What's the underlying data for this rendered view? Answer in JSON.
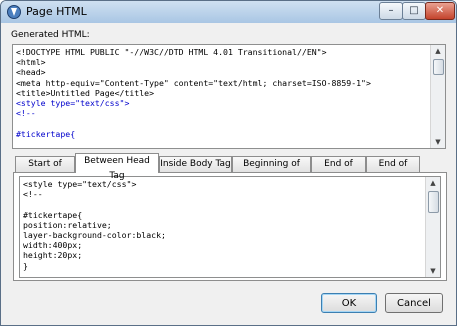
{
  "window": {
    "title": "Page HTML",
    "minimize_glyph": "–",
    "maximize_glyph": "□",
    "close_glyph": "✕"
  },
  "generated": {
    "label": "Generated HTML:",
    "lines": [
      "<!DOCTYPE HTML PUBLIC \"-//W3C//DTD HTML 4.01 Transitional//EN\">",
      "<html>",
      "<head>",
      "<meta http-equiv=\"Content-Type\" content=\"text/html; charset=ISO-8859-1\">",
      "<title>Untitled Page</title>",
      "<style type=\"text/css\">",
      "<!--",
      "",
      "#tickertape{"
    ]
  },
  "tabs": [
    {
      "label": "Start of Page",
      "active": false
    },
    {
      "label": "Between Head Tag",
      "active": true
    },
    {
      "label": "Inside Body Tag",
      "active": false
    },
    {
      "label": "Beginning of Body",
      "active": false
    },
    {
      "label": "End of Body",
      "active": false
    },
    {
      "label": "End of Page",
      "active": false
    }
  ],
  "editor": {
    "lines": [
      "<style type=\"text/css\">",
      "<!--",
      "",
      "#tickertape{",
      "position:relative;",
      "layer-background-color:black;",
      "width:400px;",
      "height:20px;",
      "}"
    ]
  },
  "buttons": {
    "ok": "OK",
    "cancel": "Cancel"
  },
  "colors": {
    "title_bar": "#b9d1ea",
    "close_button": "#c4432c",
    "code_highlight": "#0000cc"
  },
  "icons": {
    "app": "app-icon",
    "scroll_up": "scroll-up-arrow-icon",
    "scroll_down": "scroll-down-arrow-icon"
  }
}
